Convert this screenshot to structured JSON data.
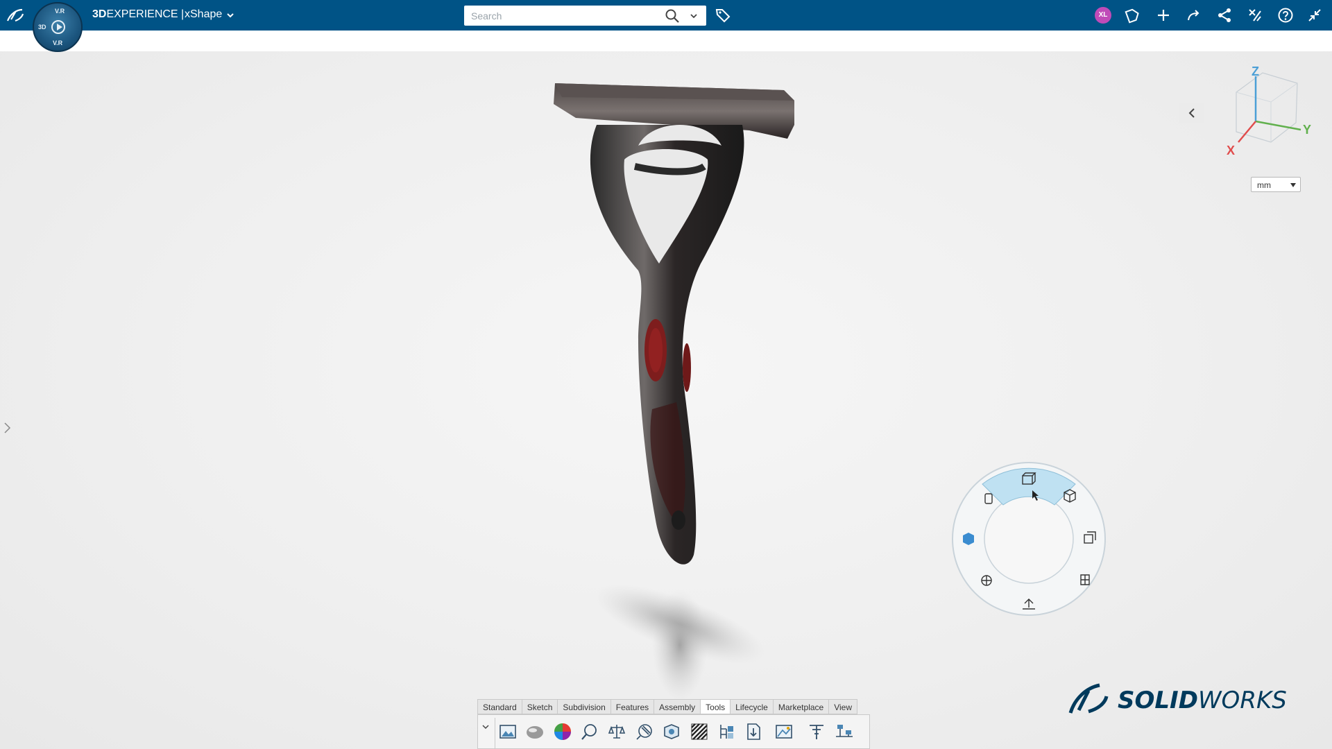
{
  "topbar": {
    "brand_bold": "3D",
    "brand_rest": "EXPERIENCE |",
    "app_name": "xShape",
    "search_placeholder": "Search",
    "avatar_initials": "XL",
    "compass_labels": {
      "top": "V.R",
      "left": "3D",
      "bottom": "V.R"
    },
    "icons": [
      "ds-logo-icon",
      "chevron-down-icon",
      "search-icon",
      "chevron-down-icon",
      "tag-icon",
      "share-icon",
      "plus-icon",
      "redo-icon",
      "share-network-icon",
      "tools-icon",
      "help-icon",
      "collapse-icon"
    ]
  },
  "viewport": {
    "units": {
      "selected": "mm"
    },
    "triad": {
      "x": "X",
      "y": "Y",
      "z": "Z"
    }
  },
  "brand": {
    "sw_bold": "SOLID",
    "sw_rest": "WORKS"
  },
  "action_bar": {
    "tabs": [
      "Standard",
      "Sketch",
      "Subdivision",
      "Features",
      "Assembly",
      "Tools",
      "Lifecycle",
      "Marketplace",
      "View"
    ],
    "active_tab": "Tools",
    "tool_icons": [
      "render-image-icon",
      "material-sphere-icon",
      "color-wheel-icon",
      "measure-zoom-icon",
      "balance-icon",
      "section-analysis-icon",
      "draft-analysis-icon",
      "zebra-stripes-icon",
      "feature-tree-icon",
      "document-download-icon",
      "image-compare-icon",
      "filter-icon",
      "align-icon"
    ]
  },
  "colors": {
    "topbar": "#005386",
    "accent": "#42a5d8",
    "brand": "#003a5c"
  }
}
